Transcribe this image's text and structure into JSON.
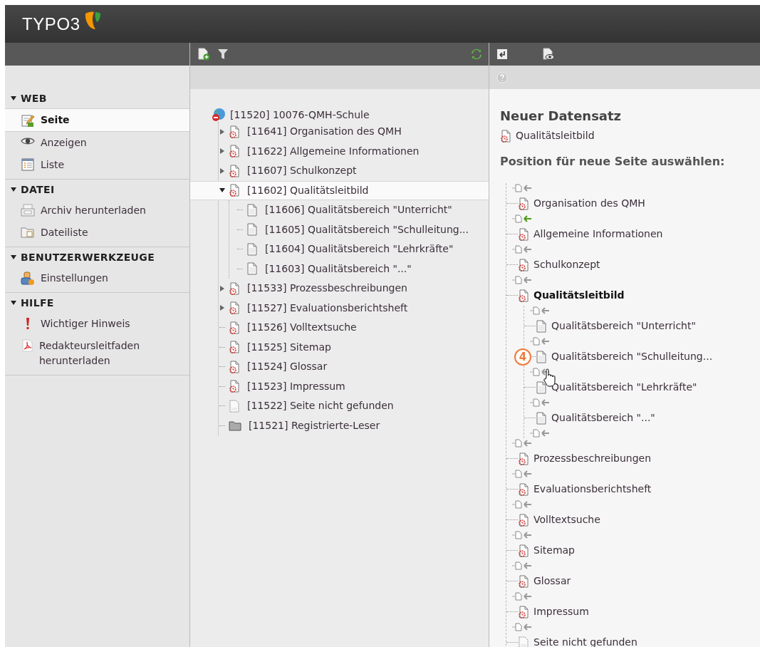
{
  "app": {
    "logo": "TYPO3"
  },
  "module_menu": [
    {
      "title": "WEB",
      "expanded": true,
      "items": [
        {
          "label": "Seite",
          "kind": "page-edit",
          "selected": true
        },
        {
          "label": "Anzeigen",
          "kind": "eye",
          "selected": false
        },
        {
          "label": "Liste",
          "kind": "list",
          "selected": false
        }
      ]
    },
    {
      "title": "DATEI",
      "expanded": true,
      "items": [
        {
          "label": "Archiv herunterladen",
          "kind": "archive",
          "selected": false
        },
        {
          "label": "Dateiliste",
          "kind": "folder-list",
          "selected": false
        }
      ]
    },
    {
      "title": "BENUTZERWERKZEUGE",
      "expanded": true,
      "items": [
        {
          "label": "Einstellungen",
          "kind": "user-settings",
          "selected": false
        }
      ]
    },
    {
      "title": "HILFE",
      "expanded": true,
      "items": [
        {
          "label": "Wichtiger Hinweis",
          "kind": "warning",
          "selected": false
        },
        {
          "label": "Redakteursleitfaden herunterladen",
          "kind": "pdf",
          "selected": false
        }
      ]
    }
  ],
  "page_tree": {
    "root": {
      "label": "[11520] 10076-QMH-Schule",
      "children": [
        {
          "label": "[11641] Organisation des QMH",
          "kind": "shortcut",
          "expanded": false,
          "selected": false
        },
        {
          "label": "[11622] Allgemeine Informationen",
          "kind": "shortcut",
          "expanded": false,
          "selected": false
        },
        {
          "label": "[11607] Schulkonzept",
          "kind": "shortcut",
          "expanded": false,
          "selected": false
        },
        {
          "label": "[11602] Qualitätsleitbild",
          "kind": "shortcut",
          "expanded": true,
          "selected": true,
          "children": [
            {
              "label": "[11606] Qualitätsbereich \"Unterricht\"",
              "kind": "standard",
              "selected": false
            },
            {
              "label": "[11605] Qualitätsbereich \"Schulleitung...",
              "kind": "standard",
              "selected": false
            },
            {
              "label": "[11604] Qualitätsbereich \"Lehrkräfte\"",
              "kind": "standard",
              "selected": false
            },
            {
              "label": "[11603] Qualitätsbereich \"...\"",
              "kind": "standard",
              "selected": false
            }
          ]
        },
        {
          "label": "[11533] Prozessbeschreibungen",
          "kind": "shortcut",
          "expanded": false,
          "selected": false
        },
        {
          "label": "[11527] Evaluationsberichtsheft",
          "kind": "shortcut",
          "expanded": false,
          "selected": false
        },
        {
          "label": "[11526] Volltextsuche",
          "kind": "shortcut",
          "selected": false
        },
        {
          "label": "[11525] Sitemap",
          "kind": "shortcut",
          "selected": false
        },
        {
          "label": "[11524] Glossar",
          "kind": "shortcut",
          "selected": false
        },
        {
          "label": "[11523] Impressum",
          "kind": "shortcut",
          "selected": false
        },
        {
          "label": "[11522] Seite nicht gefunden",
          "kind": "hidden",
          "selected": false
        },
        {
          "label": "[11521] Registrierte-Leser",
          "kind": "folder",
          "selected": false
        }
      ]
    }
  },
  "content": {
    "heading": "Neuer Datensatz",
    "record": {
      "label": "Qualitätsleitbild",
      "kind": "shortcut"
    },
    "subheading": "Position für neue Seite auswählen:",
    "positions": [
      {
        "kind": "insert",
        "selected": false,
        "hovered": false
      },
      {
        "kind": "shortcut",
        "label": "Organisation des QMH",
        "current": false
      },
      {
        "kind": "insert",
        "selected": true,
        "hovered": false
      },
      {
        "kind": "shortcut",
        "label": "Allgemeine Informationen",
        "current": false
      },
      {
        "kind": "insert",
        "selected": false,
        "hovered": false
      },
      {
        "kind": "shortcut",
        "label": "Schulkonzept",
        "current": false
      },
      {
        "kind": "insert",
        "selected": false,
        "hovered": false
      },
      {
        "kind": "shortcut",
        "label": "Qualitätsleitbild",
        "current": true,
        "children": [
          {
            "kind": "insert",
            "selected": false,
            "hovered": false
          },
          {
            "kind": "standard",
            "label": "Qualitätsbereich \"Unterricht\"",
            "current": false
          },
          {
            "kind": "insert",
            "selected": false,
            "hovered": false
          },
          {
            "kind": "standard",
            "label": "Qualitätsbereich \"Schulleitung...",
            "current": false,
            "callout": "4"
          },
          {
            "kind": "insert",
            "selected": false,
            "hovered": true
          },
          {
            "kind": "standard",
            "label": "Qualitätsbereich \"Lehrkräfte\"",
            "current": false
          },
          {
            "kind": "insert",
            "selected": false,
            "hovered": false
          },
          {
            "kind": "standard",
            "label": "Qualitätsbereich \"...\"",
            "current": false
          },
          {
            "kind": "insert",
            "selected": false,
            "hovered": false
          }
        ]
      },
      {
        "kind": "insert",
        "selected": false,
        "hovered": false
      },
      {
        "kind": "shortcut",
        "label": "Prozessbeschreibungen",
        "current": false
      },
      {
        "kind": "insert",
        "selected": false,
        "hovered": false
      },
      {
        "kind": "shortcut",
        "label": "Evaluationsberichtsheft",
        "current": false
      },
      {
        "kind": "insert",
        "selected": false,
        "hovered": false
      },
      {
        "kind": "shortcut",
        "label": "Volltextsuche",
        "current": false
      },
      {
        "kind": "insert",
        "selected": false,
        "hovered": false
      },
      {
        "kind": "shortcut",
        "label": "Sitemap",
        "current": false
      },
      {
        "kind": "insert",
        "selected": false,
        "hovered": false
      },
      {
        "kind": "shortcut",
        "label": "Glossar",
        "current": false
      },
      {
        "kind": "insert",
        "selected": false,
        "hovered": false
      },
      {
        "kind": "shortcut",
        "label": "Impressum",
        "current": false
      },
      {
        "kind": "insert",
        "selected": false,
        "hovered": false
      },
      {
        "kind": "hidden",
        "label": "Seite nicht gefunden",
        "current": false
      }
    ]
  }
}
